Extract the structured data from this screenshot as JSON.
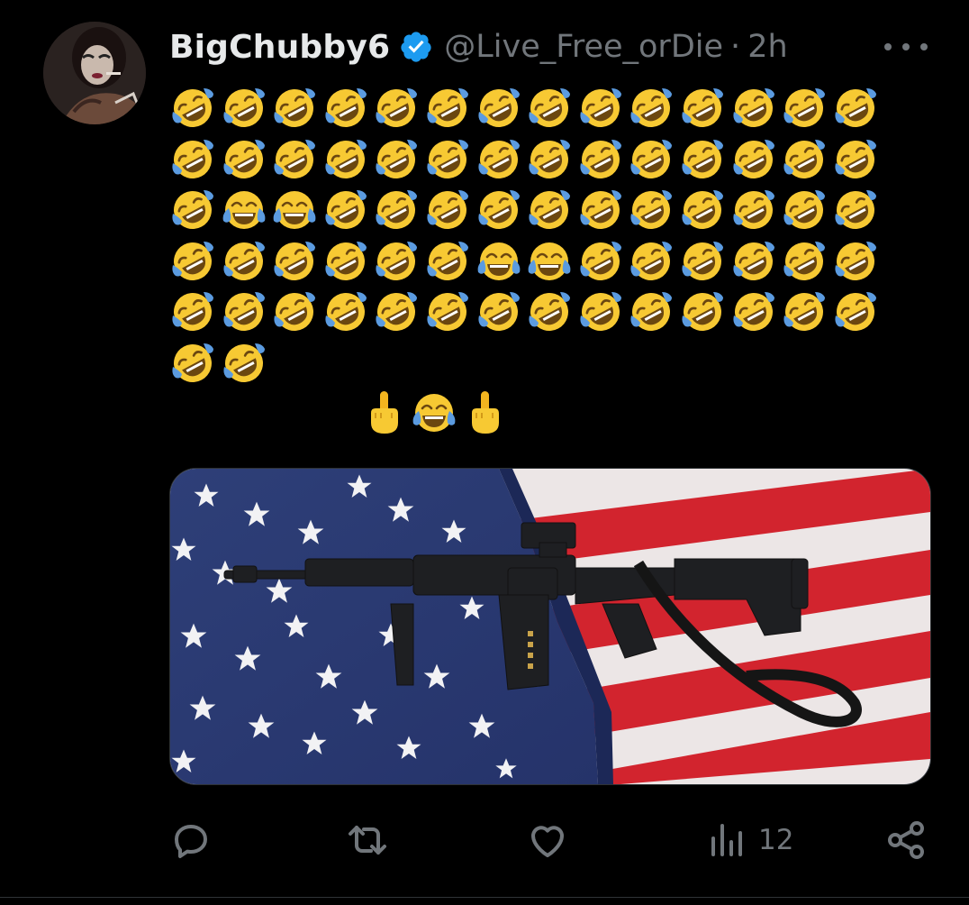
{
  "tweet": {
    "display_name": "BigChubby6",
    "handle": "@Live_Free_orDie",
    "separator": "·",
    "time": "2h",
    "verified": true,
    "colors": {
      "verified": "#1d9bf0",
      "secondary_text": "#71767b",
      "background": "#000000"
    }
  },
  "content": {
    "emoji_rows": [
      [
        "rofl",
        "rofl",
        "rofl",
        "rofl",
        "rofl",
        "rofl",
        "rofl",
        "rofl",
        "rofl",
        "rofl",
        "rofl",
        "rofl",
        "rofl",
        "rofl"
      ],
      [
        "rofl",
        "rofl",
        "rofl",
        "rofl",
        "rofl",
        "rofl",
        "rofl",
        "rofl",
        "rofl",
        "rofl",
        "rofl",
        "rofl",
        "rofl",
        "rofl"
      ],
      [
        "rofl",
        "joy",
        "joy",
        "rofl",
        "rofl",
        "rofl",
        "rofl",
        "rofl",
        "rofl",
        "rofl",
        "rofl",
        "rofl",
        "rofl",
        "rofl"
      ],
      [
        "rofl",
        "rofl",
        "rofl",
        "rofl",
        "rofl",
        "rofl",
        "joy",
        "joy",
        "rofl",
        "rofl",
        "rofl",
        "rofl",
        "rofl",
        "rofl"
      ],
      [
        "rofl",
        "rofl",
        "rofl",
        "rofl",
        "rofl",
        "rofl",
        "rofl",
        "rofl",
        "rofl",
        "rofl",
        "rofl",
        "rofl",
        "rofl",
        "rofl"
      ],
      [
        "rofl",
        "rofl"
      ]
    ],
    "emoji_line_2": [
      "middle-finger",
      "joy",
      "middle-finger"
    ],
    "media_icon": "photo-rifle-on-american-flag"
  },
  "actions": {
    "reply_icon": "reply-icon",
    "repost_icon": "repost-icon",
    "like_icon": "like-icon",
    "views_icon": "views-icon",
    "views_count": "12",
    "share_icon": "share-icon"
  }
}
